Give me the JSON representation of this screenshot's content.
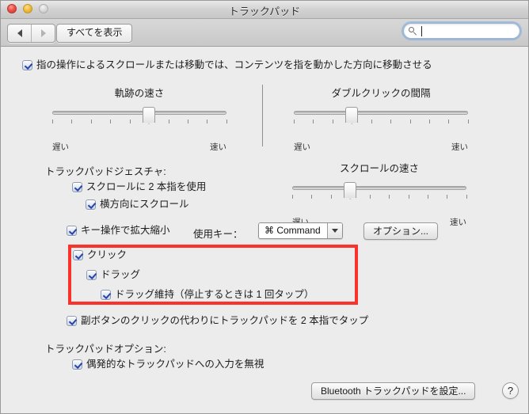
{
  "window": {
    "title": "トラックパッド",
    "traffic_lights": [
      "close",
      "minimize",
      "zoom"
    ]
  },
  "toolbar": {
    "back_label": "◀",
    "forward_label": "▶",
    "show_all_label": "すべてを表示",
    "search": {
      "value": "",
      "placeholder": "",
      "icon": "search-icon",
      "focused": true
    }
  },
  "main": {
    "natural_scroll_checkbox": {
      "label": "指の操作によるスクロールまたは移動では、コンテンツを指を動かした方向に移動させる",
      "checked": true
    },
    "sliders": [
      {
        "id": "tracking-speed",
        "title": "軌跡の速さ",
        "min_label": "遅い",
        "max_label": "速い",
        "ticks": 10,
        "value_index": 5
      },
      {
        "id": "double-click-speed",
        "title": "ダブルクリックの間隔",
        "min_label": "遅い",
        "max_label": "速い",
        "ticks": 10,
        "value_index": 3
      },
      {
        "id": "scroll-speed",
        "title": "スクロールの速さ",
        "min_label": "遅い",
        "max_label": "速い",
        "ticks": 10,
        "value_index": 3
      }
    ],
    "gestures_section": {
      "label": "トラックパッドジェスチャ:",
      "items": [
        {
          "label": "スクロールに 2 本指を使用",
          "checked": true,
          "indent": 0
        },
        {
          "label": "横方向にスクロール",
          "checked": true,
          "indent": 1
        },
        {
          "label": "キー操作で拡大縮小",
          "checked": true,
          "indent": 0
        }
      ],
      "modifier_label": "使用キー：",
      "modifier_value": "⌘ Command",
      "options_button": "オプション..."
    },
    "click_group": {
      "highlighted": true,
      "highlight_color": "#f9322c",
      "items": [
        {
          "label": "クリック",
          "checked": true,
          "indent": 0
        },
        {
          "label": "ドラッグ",
          "checked": true,
          "indent": 1
        },
        {
          "label": "ドラッグ維持（停止するときは 1 回タップ）",
          "checked": true,
          "indent": 2
        }
      ]
    },
    "secondary_click_checkbox": {
      "label": "副ボタンのクリックの代わりにトラックパッドを 2 本指でタップ",
      "checked": true
    },
    "options_section": {
      "label": "トラックパッドオプション:",
      "items": [
        {
          "label": "偶発的なトラックパッドへの入力を無視",
          "checked": true
        }
      ]
    }
  },
  "footer": {
    "setup_bluetooth_button": "Bluetooth トラックパッドを設定...",
    "help_button": "?"
  }
}
